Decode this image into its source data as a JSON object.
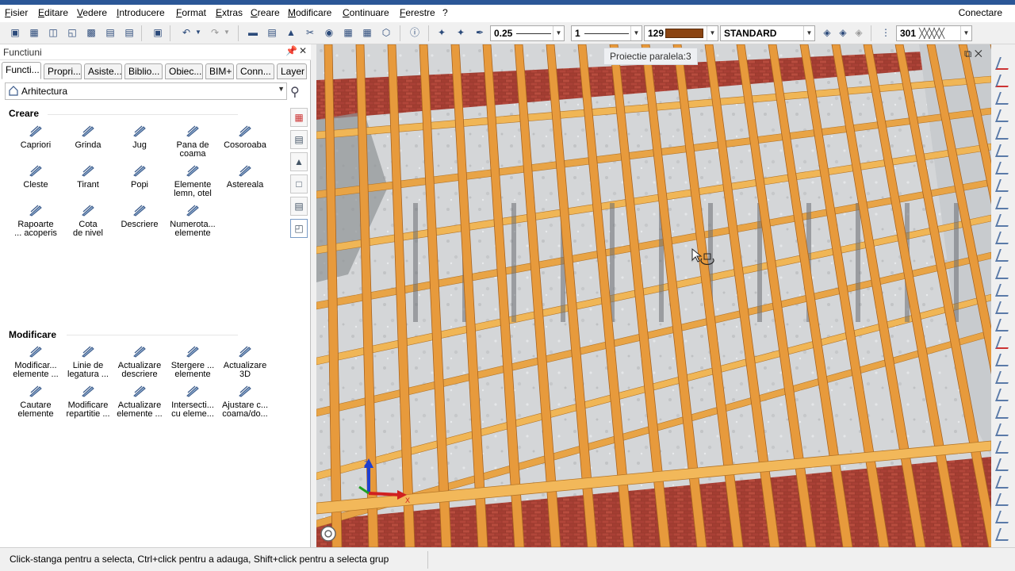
{
  "menu": [
    "Fisier",
    "Editare",
    "Vedere",
    "Introducere",
    "Format",
    "Extras",
    "Creare",
    "Modificare",
    "Continuare",
    "Ferestre",
    "?"
  ],
  "connect_label": "Conectare",
  "toolbar": {
    "line_width": "0.25",
    "line_type": "1",
    "pen_number": "129",
    "layer_style": "STANDARD",
    "hatch_number": "301",
    "pen_color": "#8b4513"
  },
  "panel": {
    "title": "Functiuni",
    "tabs": [
      "Functi...",
      "Propri...",
      "Asiste...",
      "Biblio...",
      "Obiec...",
      "BIM+",
      "Conn...",
      "Layer"
    ],
    "category": "Arhitectura",
    "sections": {
      "creare": {
        "title": "Creare",
        "items": [
          {
            "label": "Capriori",
            "icon": "rafter-icon"
          },
          {
            "label": "Grinda",
            "icon": "beam-icon"
          },
          {
            "label": "Jug",
            "icon": "yoke-icon"
          },
          {
            "label": "Pana de\ncoama",
            "icon": "ridge-purlin-icon"
          },
          {
            "label": "Cosoroaba",
            "icon": "wall-plate-icon"
          },
          {
            "label": "Cleste",
            "icon": "clamp-icon"
          },
          {
            "label": "Tirant",
            "icon": "tie-rod-icon"
          },
          {
            "label": "Popi",
            "icon": "post-icon"
          },
          {
            "label": "Elemente\nlemn, otel",
            "icon": "wood-steel-icon"
          },
          {
            "label": "Astereala",
            "icon": "sheathing-icon"
          },
          {
            "label": "Rapoarte\n... acoperis",
            "icon": "report-icon"
          },
          {
            "label": "Cota\nde nivel",
            "icon": "level-icon"
          },
          {
            "label": "Descriere",
            "icon": "label-icon"
          },
          {
            "label": "Numerota...\nelemente",
            "icon": "numbering-icon"
          }
        ]
      },
      "modificare": {
        "title": "Modificare",
        "items": [
          {
            "label": "Modificar...\nelemente ...",
            "icon": "modify-icon"
          },
          {
            "label": "Linie de\nlegatura ...",
            "icon": "connection-line-icon"
          },
          {
            "label": "Actualizare\ndescriere",
            "icon": "update-label-icon"
          },
          {
            "label": "Stergere ...\nelemente",
            "icon": "delete-numbering-icon"
          },
          {
            "label": "Actualizare\n3D",
            "icon": "update-3d-icon"
          },
          {
            "label": "Cautare\nelemente",
            "icon": "search-elements-icon"
          },
          {
            "label": "Modificare\nrepartitie ...",
            "icon": "modify-distribution-icon"
          },
          {
            "label": "Actualizare\nelemente ...",
            "icon": "update-elements-icon"
          },
          {
            "label": "Intersecti...\ncu eleme...",
            "icon": "intersect-icon"
          },
          {
            "label": "Ajustare c...\ncoama/do...",
            "icon": "adjust-ridge-icon"
          }
        ]
      }
    }
  },
  "viewport": {
    "tag": "Proiectie paralela:3",
    "axis_x": "X",
    "axis_z": "Z"
  },
  "status": "Click-stanga pentru a selecta, Ctrl+click pentru a adauga, Shift+click pentru a selecta grup"
}
